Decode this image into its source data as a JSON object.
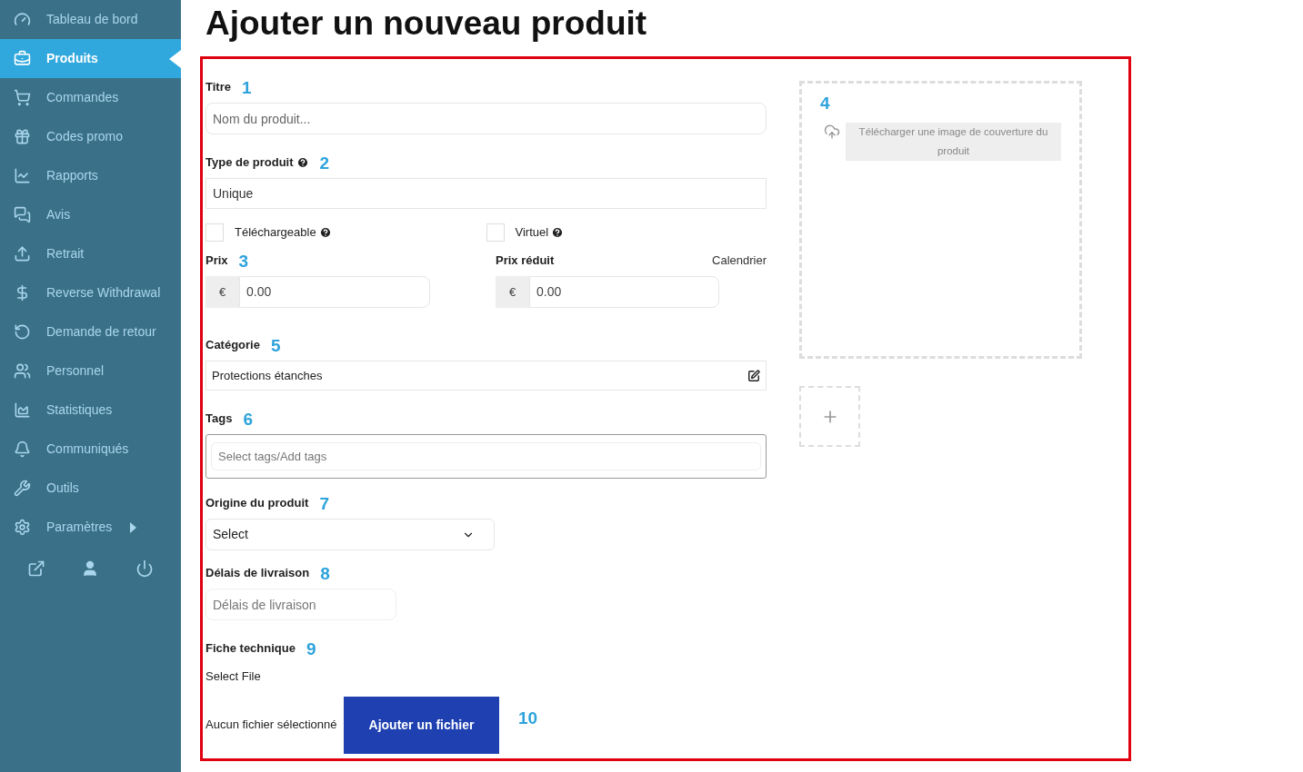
{
  "sidebar": {
    "items": [
      {
        "label": "Tableau de bord",
        "selected": false
      },
      {
        "label": "Produits",
        "selected": true
      },
      {
        "label": "Commandes",
        "selected": false
      },
      {
        "label": "Codes promo",
        "selected": false
      },
      {
        "label": "Rapports",
        "selected": false
      },
      {
        "label": "Avis",
        "selected": false
      },
      {
        "label": "Retrait",
        "selected": false
      },
      {
        "label": "Reverse Withdrawal",
        "selected": false
      },
      {
        "label": "Demande de retour",
        "selected": false
      },
      {
        "label": "Personnel",
        "selected": false
      },
      {
        "label": "Statistiques",
        "selected": false
      },
      {
        "label": "Communiqués",
        "selected": false
      },
      {
        "label": "Outils",
        "selected": false
      },
      {
        "label": "Paramètres",
        "selected": false,
        "has_submenu": true
      }
    ]
  },
  "page_title": "Ajouter un nouveau produit",
  "form": {
    "title": {
      "label": "Titre",
      "marker": "1",
      "placeholder": "Nom du produit..."
    },
    "product_type": {
      "label": "Type de produit",
      "help": true,
      "marker": "2",
      "value": "Unique"
    },
    "options": [
      {
        "label": "Téléchargeable",
        "checked": false,
        "help": true
      },
      {
        "label": "Virtuel",
        "checked": false,
        "help": true
      }
    ],
    "price": {
      "label": "Prix",
      "marker": "3",
      "currency": "€",
      "value": "0.00"
    },
    "sale_price": {
      "label": "Prix réduit",
      "link": "Calendrier",
      "currency": "€",
      "value": "0.00"
    },
    "category": {
      "label": "Catégorie",
      "marker": "5",
      "value": "Protections étanches"
    },
    "tags": {
      "label": "Tags",
      "marker": "6",
      "placeholder": "Select tags/Add tags"
    },
    "origin": {
      "label": "Origine du produit",
      "marker": "7",
      "value": "Select"
    },
    "delivery": {
      "label": "Délais de livraison",
      "marker": "8",
      "placeholder": "Délais de livraison"
    },
    "datasheet": {
      "label": "Fiche technique",
      "marker": "9",
      "select_label": "Select File",
      "status": "Aucun fichier sélectionné",
      "button": "Ajouter un fichier",
      "button_marker": "10"
    },
    "cover": {
      "marker": "4",
      "text": "Télécharger une image de couverture du produit"
    }
  }
}
